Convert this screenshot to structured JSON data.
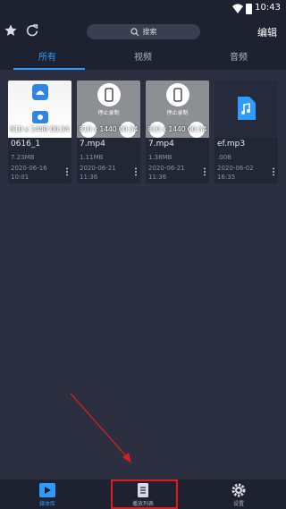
{
  "status_bar": {
    "time": "10:43"
  },
  "toolbar": {
    "search_placeholder": "搜索",
    "edit_label": "编辑"
  },
  "tabs": [
    {
      "label": "所有",
      "active": true
    },
    {
      "label": "视频",
      "active": false
    },
    {
      "label": "音频",
      "active": false
    }
  ],
  "media": [
    {
      "name": "0616_1",
      "size": "7.23MB",
      "date": "2020-06-16 10:01",
      "duration": "810 x 1440 00:34",
      "kind": "video"
    },
    {
      "name": "7.mp4",
      "size": "1.11MB",
      "date": "2020-06-21 11:36",
      "duration": "810 x 1440 00:34",
      "kind": "video",
      "overlay": "停止录制"
    },
    {
      "name": "7.mp4",
      "size": "1.38MB",
      "date": "2020-06-21 11:36",
      "duration": "810 x 1440 00:34",
      "kind": "video",
      "overlay": "停止录制"
    },
    {
      "name": "ef.mp3",
      "size": ".00B",
      "date": "2020-06-02 16:35",
      "kind": "audio"
    }
  ],
  "bottom_nav": [
    {
      "label": "媒体库",
      "active": true
    },
    {
      "label": "播放列表",
      "active": false
    },
    {
      "label": "设置",
      "active": false
    }
  ],
  "colors": {
    "accent": "#2e9bff",
    "background": "#2b2f3f",
    "bar": "#1d2130",
    "highlight": "#e01b1b"
  }
}
